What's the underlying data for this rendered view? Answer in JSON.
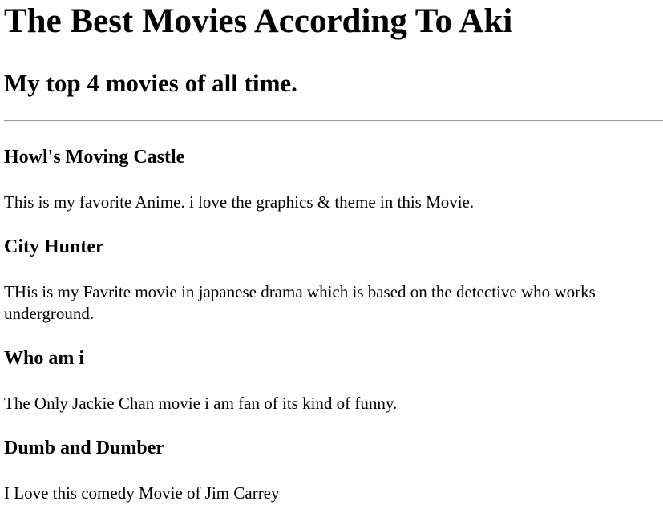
{
  "page": {
    "title": "The Best Movies According To Aki",
    "subtitle": "My top 4 movies of all time."
  },
  "movies": [
    {
      "title": "Howl's Moving Castle",
      "description": "This is my favorite Anime. i love the graphics & theme in this Movie."
    },
    {
      "title": "City Hunter",
      "description": "THis is my Favrite movie in japanese drama which is based on the detective who works underground."
    },
    {
      "title": "Who am i",
      "description": "The Only Jackie Chan movie i am fan of its kind of funny."
    },
    {
      "title": "Dumb and Dumber",
      "description": "I Love this comedy Movie of Jim Carrey"
    }
  ]
}
